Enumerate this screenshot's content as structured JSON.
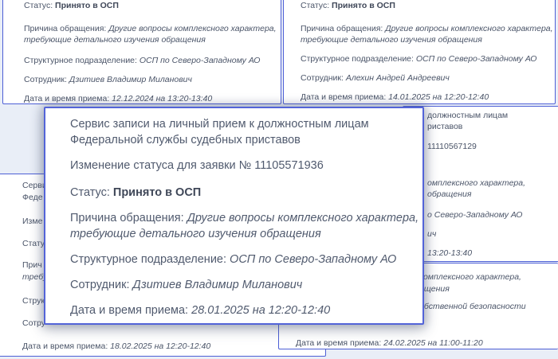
{
  "labels": {
    "status": "Статус:",
    "reason": "Причина обращения:",
    "department": "Структурное подразделение:",
    "employee": "Сотрудник:",
    "datetime": "Дата и время приема:"
  },
  "card_top_left": {
    "status_value": "Принято в ОСП",
    "reason_line1": "Другие вопросы комплексного характера,",
    "reason_line2": "требующие детального изучения обращения",
    "department_value": "ОСП по Северо-Западному АО",
    "employee_value": "Дзитиев Владимир Миланович",
    "datetime_value": "12.12.2024 на 13:20-13:40"
  },
  "card_top_right": {
    "status_value": "Принято в ОСП",
    "reason_line1": "Другие вопросы комплексного характера,",
    "reason_line2": "требующие детального изучения обращения",
    "department_value": "ОСП по Северо-Западному АО",
    "employee_value": "Алехин Андрей Андреевич",
    "datetime_value": "14.01.2025 на 12:20-12:40"
  },
  "card_mid_right": {
    "l1": "должностным лицам",
    "l2": "риставов",
    "l3": "11110567129",
    "l4": "омплексного характера,",
    "l5": "обращения",
    "l6": "о Северо-Западному АО",
    "l7": "ич",
    "l8": "13:20-13:40"
  },
  "card_bottom_left": {
    "l1": "Серви",
    "l2": "Феде",
    "l3": "Изме",
    "l4": "Стату",
    "l5": "Прич",
    "l6": "требу",
    "l7": "Струк",
    "l8": "Сотру",
    "datetime_value": "18.02.2025 на 12:20-12:40"
  },
  "card_bottom_right": {
    "l1": "комплексного характера,",
    "l2": "ащения",
    "l3": "обственной безопасности",
    "datetime_value": "24.02.2025 на 11:00-11:20"
  },
  "main_card": {
    "service_line1": "Сервис записи на личный прием к должностным лицам",
    "service_line2": "Федеральной службы судебных приставов",
    "status_change_label": "Изменение статуса для заявки №",
    "request_number": "11105571936",
    "status_value": "Принято в ОСП",
    "reason_line1": "Другие вопросы комплексного характера,",
    "reason_line2": "требующие детального изучения обращения",
    "department_value": "ОСП по Северо-Западному АО",
    "employee_value": "Дзитиев Владимир Миланович",
    "datetime_value": "28.01.2025 на 12:20-12:40"
  },
  "colors": {
    "background": "#e9eef7",
    "card_border": "#4d5fd6",
    "text": "#4a5468"
  }
}
